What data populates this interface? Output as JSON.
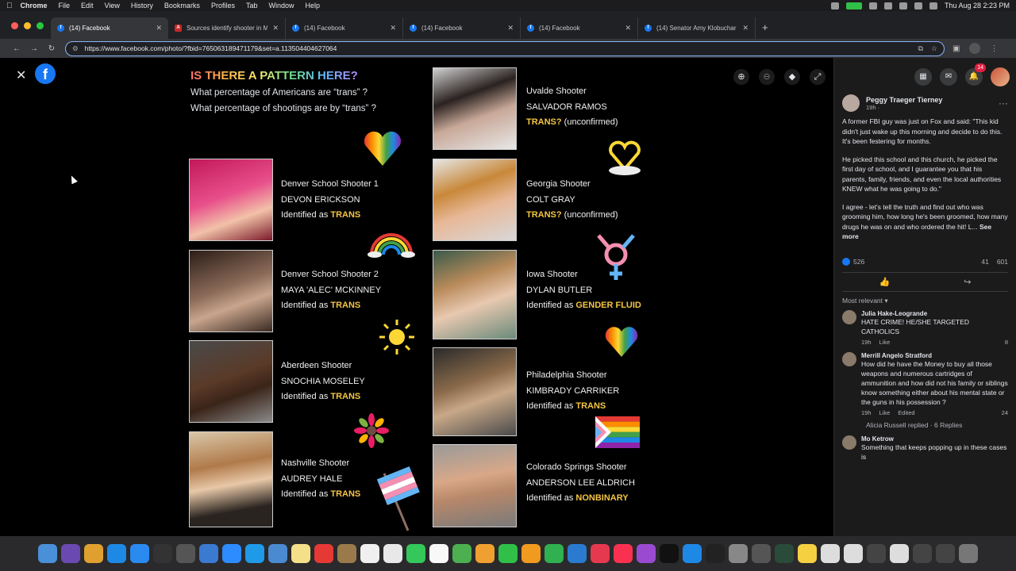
{
  "menubar": {
    "app": "Chrome",
    "items": [
      "File",
      "Edit",
      "View",
      "History",
      "Bookmarks",
      "Profiles",
      "Tab",
      "Window",
      "Help"
    ],
    "clock": "Thu Aug 28  2:23 PM"
  },
  "tabs": [
    {
      "title": "(14) Facebook",
      "icon": "facebook-icon",
      "active": true
    },
    {
      "title": "Sources identify shooter in M",
      "icon": "news-icon",
      "active": false
    },
    {
      "title": "(14) Facebook",
      "icon": "facebook-icon",
      "active": false
    },
    {
      "title": "(14) Facebook",
      "icon": "facebook-icon",
      "active": false
    },
    {
      "title": "(14) Facebook",
      "icon": "facebook-icon",
      "active": false
    },
    {
      "title": "(14) Senator Amy Klobuchar",
      "icon": "facebook-icon",
      "active": false
    }
  ],
  "address": {
    "url": "https://www.facebook.com/photo/?fbid=765063189471179&set=a.113504404627064"
  },
  "poster": {
    "title": "IS THERE A PATTERN HERE?",
    "sub1": "What percentage of Americans are “trans” ?",
    "sub2": "What percentage of shootings are by “trans” ?",
    "left": [
      {
        "line1": "Denver School Shooter 1",
        "line2": "DEVON ERICKSON",
        "prefix": "Identified as ",
        "tag": "TRANS",
        "suffix": ""
      },
      {
        "line1": "Denver School Shooter 2",
        "line2": "MAYA 'ALEC' MCKINNEY",
        "prefix": "Identified as ",
        "tag": "TRANS",
        "suffix": ""
      },
      {
        "line1": "Aberdeen Shooter",
        "line2": "SNOCHIA MOSELEY",
        "prefix": "Identified as ",
        "tag": "TRANS",
        "suffix": ""
      },
      {
        "line1": "Nashville Shooter",
        "line2": "AUDREY HALE",
        "prefix": "Identified as ",
        "tag": "TRANS",
        "suffix": ""
      }
    ],
    "right": [
      {
        "line1": "Uvalde Shooter",
        "line2": "SALVADOR RAMOS",
        "prefix": "",
        "tag": "TRANS?",
        "suffix": " (unconfirmed)"
      },
      {
        "line1": "Georgia Shooter",
        "line2": "COLT GRAY",
        "prefix": "",
        "tag": "TRANS?",
        "suffix": " (unconfirmed)"
      },
      {
        "line1": "Iowa Shooter",
        "line2": "DYLAN BUTLER",
        "prefix": "Identified as ",
        "tag": "GENDER FLUID",
        "suffix": ""
      },
      {
        "line1": "Philadelphia Shooter",
        "line2": "KIMBRADY CARRIKER",
        "prefix": "Identified as ",
        "tag": "TRANS",
        "suffix": ""
      },
      {
        "line1": "Colorado Springs Shooter",
        "line2": "ANDERSON LEE ALDRICH",
        "prefix": "Identified as ",
        "tag": "NONBINARY",
        "suffix": ""
      }
    ]
  },
  "post": {
    "author": "Peggy Traeger Tierney",
    "time": "19h ·",
    "p1": "A former FBI guy was just on Fox and said: \"This kid didn't just wake up this morning and decide to do this. It's been festering for months.",
    "p2": "He picked this school and this church, he picked the first day of school, and I guarantee you that his parents, family, friends, and even the local authorities KNEW what he was going to do.\"",
    "p3": "I agree - let's tell the truth and find out who was grooming him, how long he's been groomed, how many drugs he was on and who ordered the hit! L...",
    "see_more": "See more",
    "likes": "526",
    "comments": "41",
    "shares": "601",
    "sort": "Most relevant"
  },
  "comments": [
    {
      "name": "Julia Hake-Leogrande",
      "text": "HATE CRIME! HE/SHE TARGETED CATHOLICS",
      "time": "19h",
      "like": "Like",
      "edited": "",
      "count": "8"
    },
    {
      "name": "Merrill Angelo Stratford",
      "text": "How did he have the Money to buy all those weapons and numerous cartridges of ammunition and how did not his family or siblings know something either about his mental state or the guns in his possession ?",
      "time": "19h",
      "like": "Like",
      "edited": "Edited",
      "count": "24"
    },
    {
      "name": "Mo Ketrow",
      "text": "Something that keeps popping up in these cases is",
      "time": "",
      "like": "",
      "edited": "",
      "count": ""
    }
  ],
  "replies_text": "Alicia Russell replied · 6 Replies",
  "notif_count": "14",
  "colors": {
    "accent": "#1877f2",
    "highlight": "#f5c542"
  }
}
